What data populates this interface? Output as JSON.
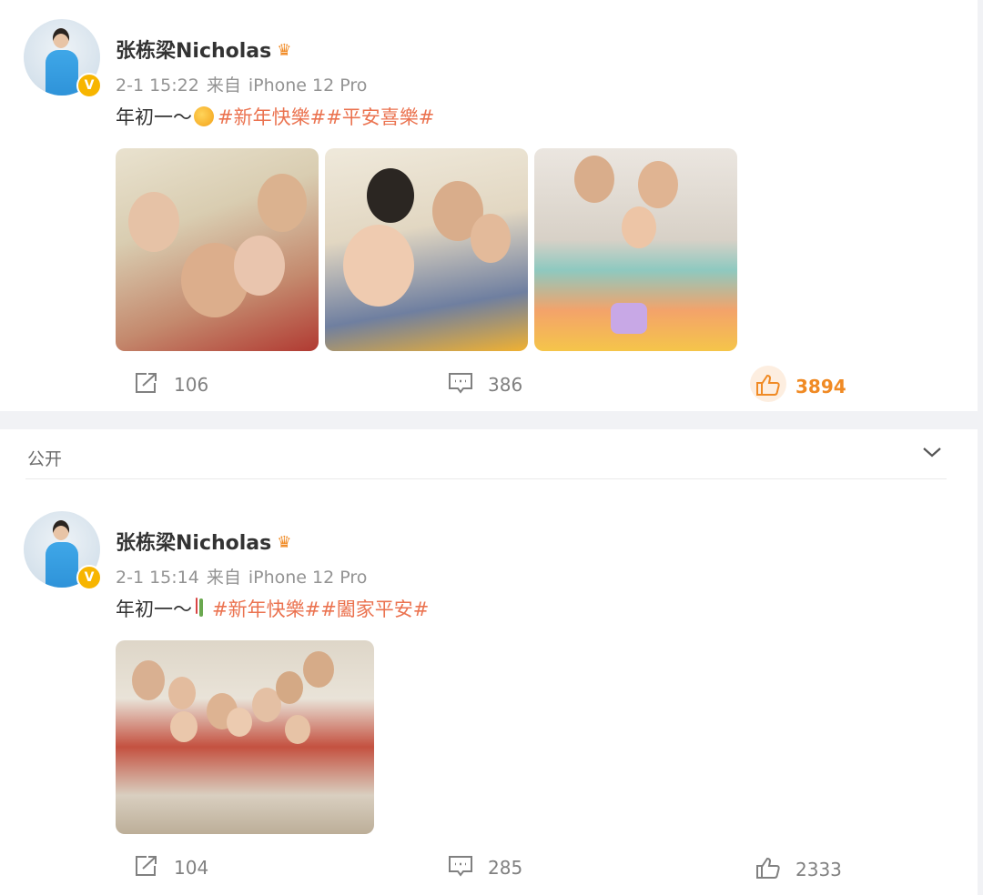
{
  "posts": [
    {
      "author": "张栋梁Nicholas",
      "verified_badge": "V",
      "time": "2-1 15:22",
      "source_prefix": "来自",
      "source": "iPhone 12 Pro",
      "text_prefix": "年初一～",
      "emoji": "smiling-face-with-hearts",
      "hashtags": [
        "#新年快樂#",
        "#平安喜樂#"
      ],
      "photos": [
        "family-selfie-photo",
        "kids-selfie-photo",
        "three-kids-photo"
      ],
      "reposts": "106",
      "comments": "386",
      "likes": "3894",
      "liked": true
    },
    {
      "author": "张栋梁Nicholas",
      "verified_badge": "V",
      "time": "2-1 15:14",
      "source_prefix": "来自",
      "source": "iPhone 12 Pro",
      "text_prefix": "年初一～",
      "emoji": "bamboo-sprig",
      "hashtags": [
        "#新年快樂#",
        "#闔家平安#"
      ],
      "photos": [
        "family-group-photo"
      ],
      "reposts": "104",
      "comments": "285",
      "likes": "2333",
      "liked": false
    }
  ],
  "visibility_label": "公开",
  "colors": {
    "hashtag": "#eb7350",
    "liked": "#f08a24",
    "meta": "#939393",
    "badge": "#f7b500"
  }
}
